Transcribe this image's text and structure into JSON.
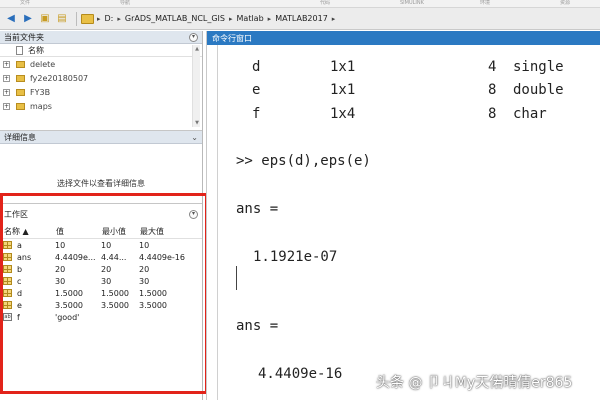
{
  "ribbon": {
    "labels": [
      "文件",
      "导航",
      "代码",
      "SIMULINK",
      "环境",
      "资源"
    ]
  },
  "toolbar": {
    "breadcrumb": [
      "D:",
      "GrADS_MATLAB_NCL_GIS",
      "Matlab",
      "MATLAB2017"
    ]
  },
  "current_folder": {
    "title": "当前文件夹",
    "column_name": "名称",
    "items": [
      "delete",
      "fy2e20180507",
      "FY3B",
      "maps"
    ]
  },
  "details": {
    "title": "详细信息",
    "message": "选择文件以查看详细信息"
  },
  "workspace": {
    "title": "工作区",
    "columns": [
      "名称 ▲",
      "值",
      "最小值",
      "最大值"
    ],
    "rows": [
      {
        "name": "a",
        "value": "10",
        "min": "10",
        "max": "10",
        "icon": "grid-icon"
      },
      {
        "name": "ans",
        "value": "4.4409e...",
        "min": "4.44...",
        "max": "4.4409e-16",
        "icon": "grid-icon"
      },
      {
        "name": "b",
        "value": "20",
        "min": "20",
        "max": "20",
        "icon": "grid-icon"
      },
      {
        "name": "c",
        "value": "30",
        "min": "30",
        "max": "30",
        "icon": "grid-icon"
      },
      {
        "name": "d",
        "value": "1.5000",
        "min": "1.5000",
        "max": "1.5000",
        "icon": "grid-icon"
      },
      {
        "name": "e",
        "value": "3.5000",
        "min": "3.5000",
        "max": "3.5000",
        "icon": "grid-icon"
      },
      {
        "name": "f",
        "value": "'good'",
        "min": "",
        "max": "",
        "icon": "char-icon"
      }
    ]
  },
  "command_window": {
    "title": "命令行窗口",
    "whos_rows": [
      {
        "name": "d",
        "size": "1x1",
        "bytes": "4",
        "class": "single"
      },
      {
        "name": "e",
        "size": "1x1",
        "bytes": "8",
        "class": "double"
      },
      {
        "name": "f",
        "size": "1x4",
        "bytes": "8",
        "class": "char"
      }
    ],
    "command": ">> eps(d),eps(e)",
    "ans1_label": "ans =",
    "ans1_value": "1.1921e-07",
    "ans2_label": "ans =",
    "ans2_value": "4.4409e-16"
  },
  "watermark": "头条 @ 卩ㄐMy天偌晴倩er865",
  "colors": {
    "command_header": "#2b79c2",
    "highlight_box": "#e2231a",
    "panel_header": "#dfe6ee"
  }
}
